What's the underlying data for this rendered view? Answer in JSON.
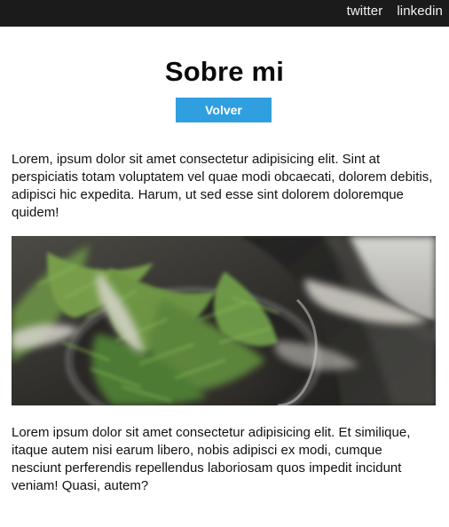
{
  "nav": {
    "links": [
      {
        "label": "twitter"
      },
      {
        "label": "linkedin"
      }
    ]
  },
  "page": {
    "title": "Sobre mi",
    "back_label": "Volver",
    "intro": "Lorem, ipsum dolor sit amet consectetur adipisicing elit. Sint at perspiciatis totam voluptatem vel quae modi obcaecati, dolorem debitis, adipisci hic expedita. Harum, ut sed esse sint dolorem doloremque quidem!",
    "image_subject": "potted-plant-photo",
    "outro": "Lorem ipsum dolor sit amet consectetur adipisicing elit. Et similique, itaque autem nisi earum libero, nobis adipisci ex modi, cumque nesciunt perferendis repellendus laboriosam quos impedit incidunt veniam! Quasi, autem?"
  },
  "colors": {
    "topbar": "#1b1b1b",
    "button": "#2f9fe0",
    "text": "#111111"
  }
}
